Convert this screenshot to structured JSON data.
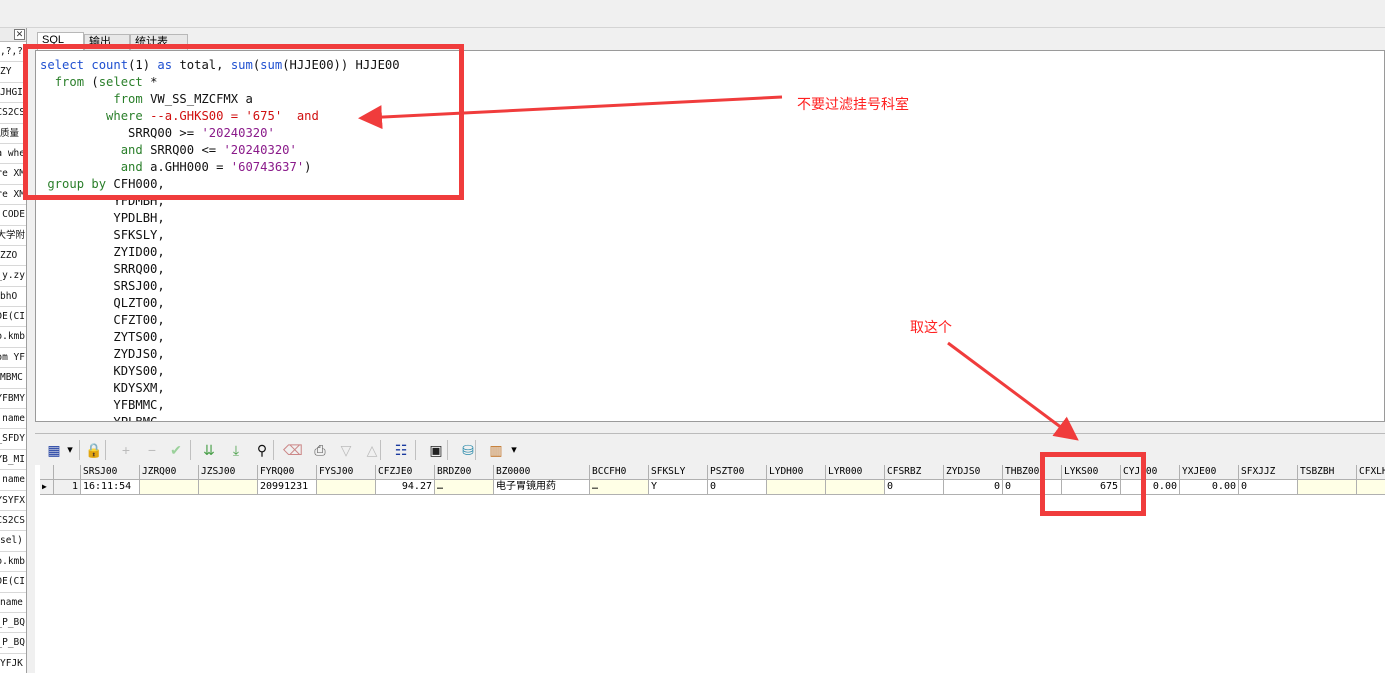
{
  "tabs": [
    {
      "label": "SQL"
    },
    {
      "label": "输出"
    },
    {
      "label": "统计表"
    }
  ],
  "left_items": [
    "?,?,",
    "ZY",
    "JHGI",
    "CS2CS",
    "质量",
    "a whe",
    "re XM",
    "re XM",
    "CODE,",
    "大学附",
    "ZZO",
    "y.zy_",
    "bhO",
    "DE(CI",
    "o.kmb",
    "om YF",
    "MBMC",
    "YFBMY",
    "name,",
    "SFDY_",
    "YB_MI",
    "name,",
    "YSYFX",
    "CS2CS",
    "(sel",
    "o.kmb",
    "DE(CI",
    "name",
    "P_BQ_",
    "P_BQ_",
    "YFJK"
  ],
  "sql_lines": [
    [
      {
        "t": "select ",
        "c": "fn"
      },
      {
        "t": "count",
        "c": "fn"
      },
      {
        "t": "(1) ",
        "c": ""
      },
      {
        "t": "as ",
        "c": "fn"
      },
      {
        "t": "total, ",
        "c": ""
      },
      {
        "t": "sum",
        "c": "fn"
      },
      {
        "t": "(",
        "c": ""
      },
      {
        "t": "sum",
        "c": "fn"
      },
      {
        "t": "(HJJE00)) HJJE00",
        "c": ""
      }
    ],
    [
      {
        "t": "  ",
        "c": ""
      },
      {
        "t": "from ",
        "c": "kw"
      },
      {
        "t": "(",
        "c": ""
      },
      {
        "t": "select ",
        "c": "kw"
      },
      {
        "t": "*",
        "c": ""
      }
    ],
    [
      {
        "t": "          ",
        "c": ""
      },
      {
        "t": "from ",
        "c": "kw"
      },
      {
        "t": "VW_SS_MZCFMX a",
        "c": ""
      }
    ],
    [
      {
        "t": "         ",
        "c": ""
      },
      {
        "t": "where ",
        "c": "kw"
      },
      {
        "t": "--a.GHKS00 = '675'  and",
        "c": "cmt"
      }
    ],
    [
      {
        "t": "            SRRQ00 >= ",
        "c": ""
      },
      {
        "t": "'20240320'",
        "c": "str"
      }
    ],
    [
      {
        "t": "           ",
        "c": ""
      },
      {
        "t": "and ",
        "c": "kw"
      },
      {
        "t": "SRRQ00 <= ",
        "c": ""
      },
      {
        "t": "'20240320'",
        "c": "str"
      }
    ],
    [
      {
        "t": "           ",
        "c": ""
      },
      {
        "t": "and ",
        "c": "kw"
      },
      {
        "t": "a.GHH000 = ",
        "c": ""
      },
      {
        "t": "'60743637'",
        "c": "str"
      },
      {
        "t": ")",
        "c": ""
      }
    ],
    [
      {
        "t": " ",
        "c": ""
      },
      {
        "t": "group by ",
        "c": "kw"
      },
      {
        "t": "CFH000,",
        "c": ""
      }
    ],
    [
      {
        "t": "          YFDMBH,",
        "c": ""
      }
    ],
    [
      {
        "t": "          YPDLBH,",
        "c": ""
      }
    ],
    [
      {
        "t": "          SFKSLY,",
        "c": ""
      }
    ],
    [
      {
        "t": "          ZYID00,",
        "c": ""
      }
    ],
    [
      {
        "t": "          SRRQ00,",
        "c": ""
      }
    ],
    [
      {
        "t": "          SRSJ00,",
        "c": ""
      }
    ],
    [
      {
        "t": "          QLZT00,",
        "c": ""
      }
    ],
    [
      {
        "t": "          CFZT00,",
        "c": ""
      }
    ],
    [
      {
        "t": "          ZYTS00,",
        "c": ""
      }
    ],
    [
      {
        "t": "          ZYDJS0,",
        "c": ""
      }
    ],
    [
      {
        "t": "          KDYS00,",
        "c": ""
      }
    ],
    [
      {
        "t": "          KDYSXM,",
        "c": ""
      }
    ],
    [
      {
        "t": "          YFBMMC,",
        "c": ""
      }
    ],
    [
      {
        "t": "          YPLBMC,",
        "c": ""
      }
    ]
  ],
  "toolbar": [
    "grid-icon",
    "dropdown-icon",
    "lock-icon",
    "add-icon",
    "remove-icon",
    "confirm-icon",
    "fetch-next-icon",
    "fetch-all-icon",
    "find-icon",
    "clear-icon",
    "print-icon",
    "filter-down-icon",
    "filter-up-icon",
    "tree-icon",
    "save-icon",
    "export-icon",
    "chart-icon",
    "dropdown-icon"
  ],
  "grid": {
    "columns": [
      "SRSJ00",
      "JZRQ00",
      "JZSJ00",
      "FYRQ00",
      "FYSJ00",
      "CFZJE0",
      "BRDZ00",
      "BZ0000",
      "BCCFH0",
      "SFKSLY",
      "PSZT00",
      "LYDH00",
      "LYR000",
      "CFSRBZ",
      "ZYDJS0",
      "THBZ00",
      "LYKS00",
      "CYJE00",
      "YXJE00",
      "SFXJJZ",
      "TSBZBH",
      "CFXLH"
    ],
    "row_num": "1",
    "row": [
      "16:11:54",
      "",
      "",
      "20991231",
      "",
      "94.27",
      "…",
      "电子胃镜用药",
      "…",
      "Y",
      "0",
      "",
      "",
      "0",
      "0",
      "0",
      "675",
      "0.00",
      "0.00",
      "0",
      "",
      ""
    ]
  },
  "annotations": {
    "note1": "不要过滤挂号科室",
    "note2": "取这个"
  }
}
